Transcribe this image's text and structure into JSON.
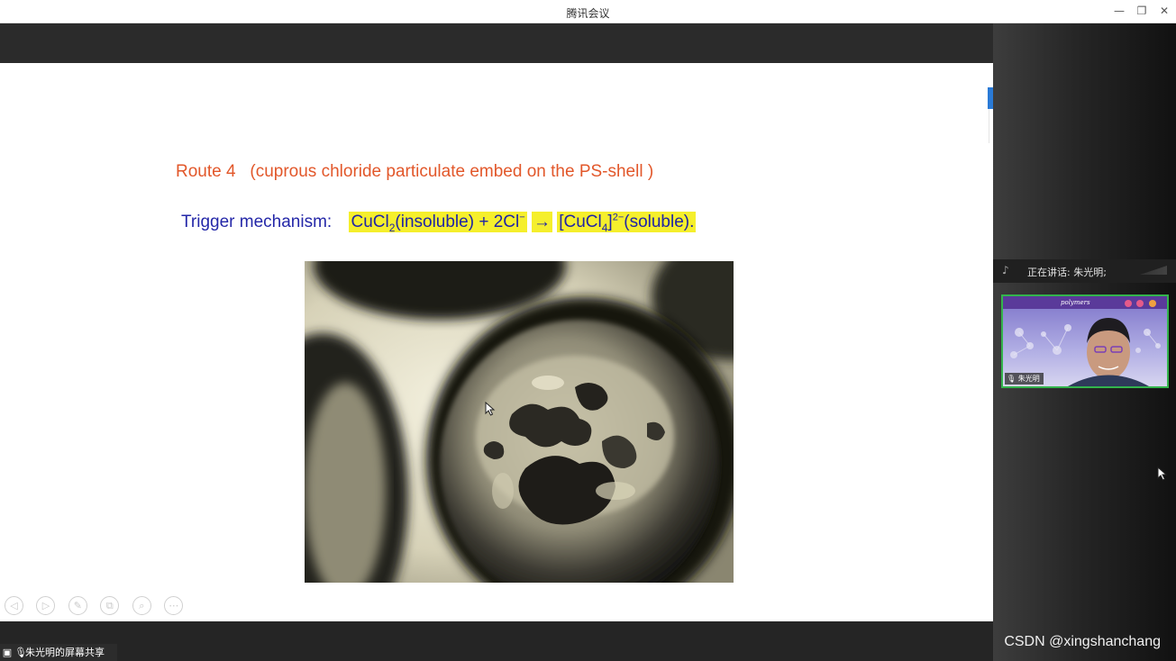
{
  "window": {
    "title": "腾讯会议",
    "minimize_glyph": "—",
    "restore_glyph": "❐",
    "close_glyph": "✕"
  },
  "slide": {
    "route_title": "Route 4   (cuprous chloride particulate embed on the PS-shell )",
    "trigger_label": "Trigger mechanism:",
    "eq": {
      "cucl": "CuCl",
      "sub2": "2",
      "insoluble": "(insoluble) + 2Cl",
      "minus": "−",
      "arrow": "→",
      "bracket_open": "[CuCl",
      "sub4": "4",
      "bracket_close": "]",
      "sup2minus": "2−",
      "soluble": "(soluble)."
    }
  },
  "slide_tools": [
    {
      "icon": "prev-icon",
      "glyph": "◁"
    },
    {
      "icon": "next-icon",
      "glyph": "▷"
    },
    {
      "icon": "pen-icon",
      "glyph": "✎"
    },
    {
      "icon": "copy-icon",
      "glyph": "⧉"
    },
    {
      "icon": "zoom-icon",
      "glyph": "⌕"
    },
    {
      "icon": "more-icon",
      "glyph": "⋯"
    }
  ],
  "share_label": "朱光明的屏幕共享",
  "speaking": {
    "text": "正在讲话: 朱光明;"
  },
  "video": {
    "header_text": "polymers",
    "name": "朱光明"
  },
  "watermark": "CSDN @xingshanchang",
  "colors": {
    "route_title": "#e2572a",
    "trigger": "#2427a8",
    "highlight": "#f5ef2c",
    "video_border": "#33b44c"
  }
}
